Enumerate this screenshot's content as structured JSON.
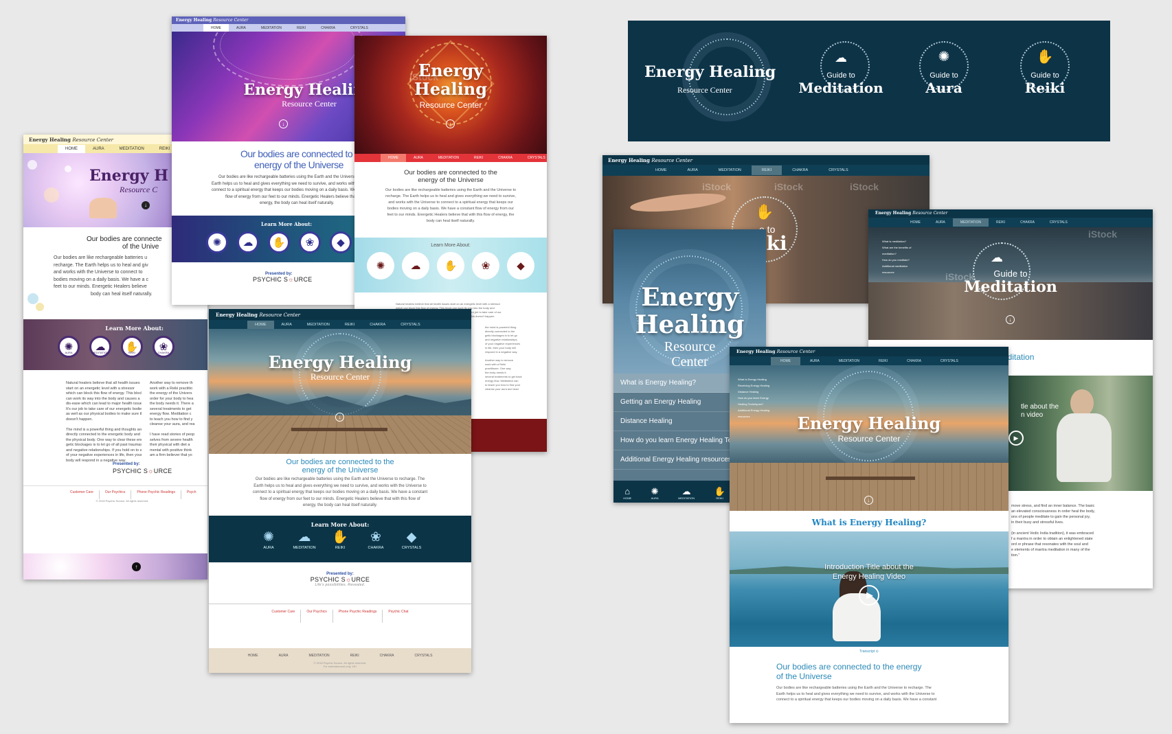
{
  "brand": {
    "name": "Energy Healing",
    "suffix": "Resource Center",
    "subtitle": "Resource Center"
  },
  "nav_items": [
    "HOME",
    "AURA",
    "MEDITATION",
    "REIKI",
    "CHAKRA",
    "CRYSTALS"
  ],
  "banner": {
    "title_line": "Energy Healing",
    "sub": "Resource Center",
    "guides": [
      {
        "pre": "Guide to",
        "name": "Meditation",
        "icon": "lotus-stone-icon"
      },
      {
        "pre": "Guide to",
        "name": "Aura",
        "icon": "sun-icon"
      },
      {
        "pre": "Guide to",
        "name": "Reiki",
        "icon": "hand-icon"
      }
    ]
  },
  "hero": {
    "line1": "Energy",
    "line2": "Healing",
    "line3": "Energy H",
    "line4": "Resource C"
  },
  "intro": {
    "heading1": "Our bodies are connected to the",
    "heading2": "energy of the Universe",
    "heading_full1": "Our bodies are connected to the energy",
    "heading_full2": "of the Universe",
    "heading_cut1": "Our bodies are connecte",
    "heading_cut2": "of the Unive",
    "p1": "Our bodies are like rechargeable batteries using the Earth and the Universe to recharge. The",
    "p2": "Earth helps us to heal and gives everything we need to survive, and works with the Universe to",
    "p3": "connect to a spiritual energy that keeps our bodies moving on a daily basis. We have a constant",
    "p4": "flow of energy from our feet to our minds. Energetic Healers believe that with this flow of",
    "p5": "energy, the body can heal itself naturally."
  },
  "learn": {
    "title": "Learn More About:",
    "items": [
      {
        "label": "AURA",
        "icon": "sun-icon",
        "glyph": "✺"
      },
      {
        "label": "MEDITATION",
        "icon": "lotus-stone-icon",
        "glyph": "☁"
      },
      {
        "label": "REIKI",
        "icon": "hand-icon",
        "glyph": "✋"
      },
      {
        "label": "CHAKRA",
        "icon": "lotus-icon",
        "glyph": "❀"
      },
      {
        "label": "CRYSTALS",
        "icon": "crystal-icon",
        "glyph": "◆"
      }
    ]
  },
  "presented": {
    "label": "Presented by:",
    "brand_a": "PSYCHIC S",
    "brand_b": "URCE",
    "tagline": "Life's possibilities. Revealed."
  },
  "footer_links": [
    "Customer Care",
    "Our Psychics",
    "Phone Psychic Readings",
    "Psychic Chat"
  ],
  "footer_links_cut": [
    "Customer Care",
    "Our Psychics",
    "Phone Psychic Readings",
    "Psych"
  ],
  "side_menu": [
    "What is Energy Healing?",
    "Getting an Energy Healing",
    "Distance Healing",
    "How do you learn Energy Healing Te",
    "Additional Energy Healing resources"
  ],
  "toc": [
    "What is Energy Healing",
    "Receiving Energy Healing",
    "Distance Healing",
    "How do you learn Energy",
    "Healing Techniques?",
    "Additional Energy Healing",
    "resources"
  ],
  "meditation_toc": [
    "What is meditation?",
    "What are the benefits of",
    "meditation?",
    "How do you meditate?",
    "Additional meditation",
    "resources"
  ],
  "video": {
    "heading": "What is Energy Healing?",
    "title1": "Introduction Title about the",
    "title2": "Energy Healing Video",
    "transcript": "Transcript",
    "cut1": "tle about the",
    "cut2": "n video"
  },
  "guide_reiki": {
    "pre": "e to",
    "name": "iki"
  },
  "guide_med": {
    "pre": "Guide to",
    "name": "Meditation",
    "cut": "editation"
  },
  "side_hero": {
    "l1": "Energy",
    "l2": "Healing",
    "l3": "Resource",
    "l4": "Center"
  },
  "watermark": "iStock",
  "copyright": "© 2018 Psychic Source. All rights reserved.",
  "entertainment": "For entertainment only. 18+",
  "colors": {
    "teal_dark": "#0c3447",
    "purple": "#4a2c73",
    "red": "#c8272c",
    "light_blue": "#aee0ea",
    "link_blue": "#2a89b8"
  }
}
